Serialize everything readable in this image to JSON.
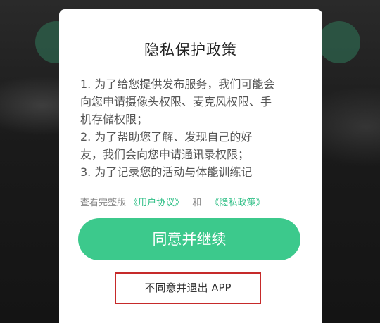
{
  "dialog": {
    "title": "隐私保护政策",
    "body_lines": [
      "1. 为了给您提供发布服务，我们可能会",
      "向您申请摄像头权限、麦克风权限、手",
      "机存储权限；",
      "2. 为了帮助您了解、发现自己的好",
      "友，我们会向您申请通讯录权限；",
      "3. 为了记录您的活动与体能训练记"
    ],
    "links_prefix": "查看完整版",
    "user_agreement_link": "《用户协议》",
    "links_conjunction": "和",
    "privacy_policy_link": "《隐私政策》",
    "agree_button_label": "同意并继续",
    "disagree_button_label": "不同意并退出 APP"
  },
  "colors": {
    "accent_green": "#3cc98c",
    "link_green": "#2fbf86",
    "highlight_red": "#c62a2a"
  }
}
